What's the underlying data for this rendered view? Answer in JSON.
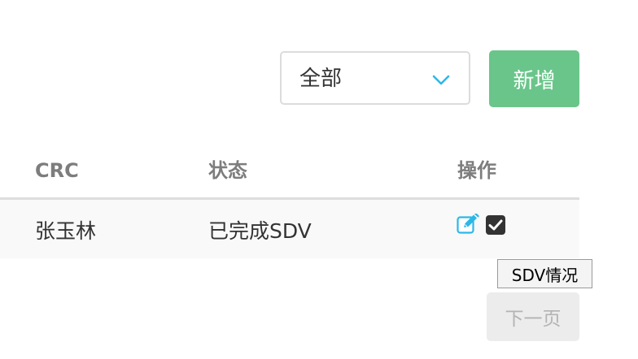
{
  "toolbar": {
    "status_filter": {
      "selected": "全部"
    },
    "add_label": "新增"
  },
  "table": {
    "columns": [
      "CRC",
      "状态",
      "操作"
    ],
    "rows": [
      {
        "crc": "张玉林",
        "status": "已完成SDV",
        "actions": [
          "edit-icon",
          "checkbox-checked-icon"
        ]
      }
    ]
  },
  "tooltip": "SDV情况",
  "pagination": {
    "next_label": "下一页"
  },
  "colors": {
    "accent_green": "#6ac58a",
    "accent_cyan": "#2cb8e6",
    "header_text": "#7d7d7d"
  }
}
